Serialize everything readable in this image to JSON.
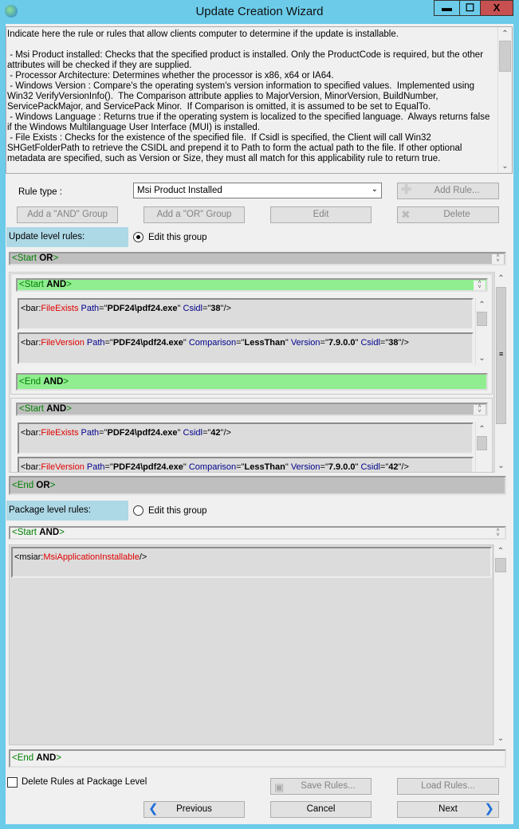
{
  "window": {
    "title": "Update Creation Wizard",
    "minimize": "▬",
    "maximize": "☐",
    "close": "X"
  },
  "description": "Indicate here the rule or rules that allow clients computer to determine if the update is installable.\n\n - Msi Product installed: Checks that the specified product is installed. Only the ProductCode is required, but the other attributes will be checked if they are supplied.\n - Processor Architecture: Determines whether the processor is x86, x64 or IA64.\n - Windows Version : Compare's the operating system's version information to specified values.  Implemented using Win32 VerifyVersionInfo().  The Comparison attribute applies to MajorVersion, MinorVersion, BuildNumber, ServicePackMajor, and ServicePack Minor.  If Comparison is omitted, it is assumed to be set to EqualTo.\n - Windows Language : Returns true if the operating system is localized to the specified language.  Always returns false if the Windows Multilanguage User Interface (MUI) is installed.\n - File Exists : Checks for the existence of the specified file.  If Csidl is specified, the Client will call Win32 SHGetFolderPath to retrieve the CSIDL and prepend it to Path to form the actual path to the file. If other optional metadata are specified, such as Version or Size, they must all match for this applicability rule to return true.",
  "rule_type": {
    "label": "Rule type :",
    "value": "Msi Product Installed"
  },
  "buttons": {
    "add_rule": "Add Rule...",
    "add_and": "Add a \"AND\" Group",
    "add_or": "Add a \"OR\" Group",
    "edit": "Edit",
    "delete": "Delete",
    "save_rules": "Save Rules...",
    "load_rules": "Load Rules...",
    "previous": "Previous",
    "cancel": "Cancel",
    "next": "Next"
  },
  "update_level": {
    "label": "Update level rules:",
    "radio_label": "Edit this group",
    "radio_checked": true,
    "start": {
      "tag": "<Start ",
      "op": "OR",
      "close": ">"
    },
    "end": {
      "tag": "<End ",
      "op": "OR",
      "close": ">"
    },
    "groups": [
      {
        "start": {
          "tag": "<Start ",
          "op": "AND",
          "close": ">"
        },
        "end": {
          "tag": "<End ",
          "op": "AND",
          "close": ">"
        },
        "selected": true,
        "rules": [
          {
            "prefix": "<bar:",
            "name": "FileExists",
            "attrs": [
              {
                "k": "Path",
                "v": "PDF24\\pdf24.exe"
              },
              {
                "k": "Csidl",
                "v": "38"
              }
            ],
            "suffix": "/>"
          },
          {
            "prefix": "<bar:",
            "name": "FileVersion",
            "attrs": [
              {
                "k": "Path",
                "v": "PDF24\\pdf24.exe"
              },
              {
                "k": "Comparison",
                "v": "LessThan"
              },
              {
                "k": "Version",
                "v": "7.9.0.0"
              },
              {
                "k": "Csidl",
                "v": "38"
              }
            ],
            "suffix": "/>"
          }
        ]
      },
      {
        "start": {
          "tag": "<Start ",
          "op": "AND",
          "close": ">"
        },
        "selected": false,
        "rules": [
          {
            "prefix": "<bar:",
            "name": "FileExists",
            "attrs": [
              {
                "k": "Path",
                "v": "PDF24\\pdf24.exe"
              },
              {
                "k": "Csidl",
                "v": "42"
              }
            ],
            "suffix": "/>"
          },
          {
            "prefix": "<bar:",
            "name": "FileVersion",
            "attrs": [
              {
                "k": "Path",
                "v": "PDF24\\pdf24.exe"
              },
              {
                "k": "Comparison",
                "v": "LessThan"
              },
              {
                "k": "Version",
                "v": "7.9.0.0"
              },
              {
                "k": "Csidl",
                "v": "42"
              }
            ],
            "suffix": "/>"
          }
        ]
      }
    ]
  },
  "package_level": {
    "label": "Package level rules:",
    "radio_label": "Edit this group",
    "radio_checked": false,
    "start": {
      "tag": "<Start ",
      "op": "AND",
      "close": ">"
    },
    "end": {
      "tag": "<End ",
      "op": "AND",
      "close": ">"
    },
    "rules": [
      {
        "prefix": "<msiar:",
        "name": "MsiApplicationInstallable",
        "attrs": [],
        "suffix": "/>"
      }
    ]
  },
  "delete_pkg_checkbox": {
    "label": "Delete Rules at Package Level",
    "checked": false
  },
  "colors": {
    "titlebar": "#6bcbe9",
    "close": "#c75050",
    "selected_group": "#90ee90",
    "section_label": "#add8e6",
    "rule_name": "#e00000",
    "attr_name": "#00008b",
    "tag": "#008000"
  }
}
